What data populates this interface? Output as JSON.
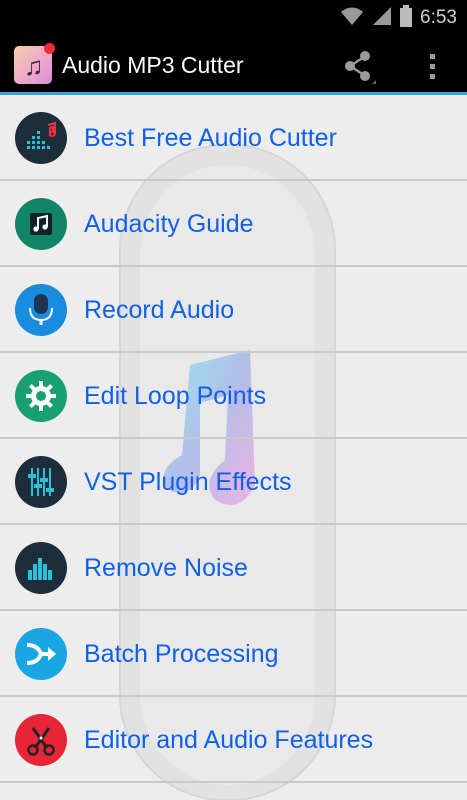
{
  "status_bar": {
    "time": "6:53"
  },
  "action_bar": {
    "title": "Audio MP3 Cutter",
    "share_icon": "share-icon",
    "overflow_icon": "overflow-menu-icon"
  },
  "colors": {
    "accent_line": "#3aa3dc",
    "label_text": "#1060e8",
    "list_background": "#ededed"
  },
  "menu": {
    "items": [
      {
        "label": "Best Free Audio Cutter",
        "icon": "equalizer-note-icon",
        "icon_bg": "#1d2e3a"
      },
      {
        "label": "Audacity Guide",
        "icon": "music-note-icon",
        "icon_bg": "#128466"
      },
      {
        "label": "Record Audio",
        "icon": "microphone-icon",
        "icon_bg": "#1a8ce0"
      },
      {
        "label": "Edit Loop Points",
        "icon": "gear-icon",
        "icon_bg": "#18a070"
      },
      {
        "label": "VST Plugin Effects",
        "icon": "sliders-icon",
        "icon_bg": "#1d2e3a"
      },
      {
        "label": "Remove Noise",
        "icon": "bars-icon",
        "icon_bg": "#1d2e3a"
      },
      {
        "label": "Batch Processing",
        "icon": "merge-arrows-icon",
        "icon_bg": "#1aa6e4"
      },
      {
        "label": "Editor and Audio Features",
        "icon": "scissors-icon",
        "icon_bg": "#e82538"
      }
    ]
  }
}
